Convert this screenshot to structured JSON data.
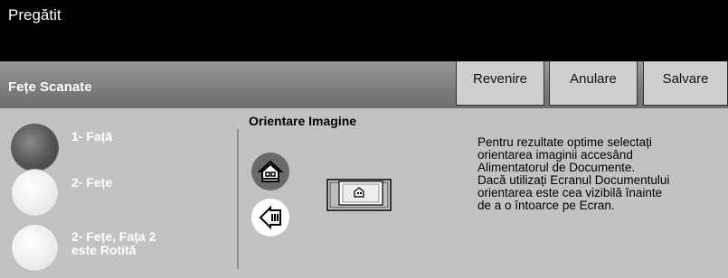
{
  "status": {
    "message": "Pregătit"
  },
  "header": {
    "title": "Fețe Scanate"
  },
  "toolbar": {
    "back_label": "Revenire",
    "cancel_label": "Anulare",
    "save_label": "Salvare"
  },
  "sides": {
    "options": [
      {
        "line1": "1- Față",
        "line2": "",
        "selected": true
      },
      {
        "line1": "2- Fețe",
        "line2": "",
        "selected": false
      },
      {
        "line1": "2- Fețe, Fața 2",
        "line2": "este Rotită",
        "selected": false
      }
    ]
  },
  "orientation": {
    "title": "Orientare Imagine",
    "options": [
      {
        "icon": "upright-house-icon",
        "selected": true
      },
      {
        "icon": "sideways-house-icon",
        "selected": false
      }
    ],
    "preview_icon": "document-feeder-preview-icon"
  },
  "help": {
    "lines": [
      "Pentru rezultate optime selectați",
      "orientarea imaginii accesând",
      "Alimentatorul de Documente.",
      "Dacă utilizați Ecranul Documentului",
      "orientarea este cea vizibilă înainte",
      "de a o întoarce pe Ecran."
    ]
  }
}
